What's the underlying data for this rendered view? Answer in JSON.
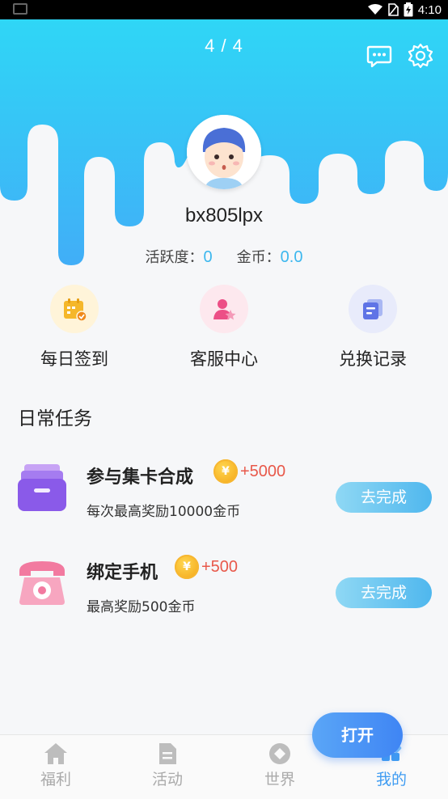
{
  "status_bar": {
    "time": "4:10"
  },
  "header": {
    "page_indicator": "4 / 4",
    "chat_icon": "chat-bubble-icon",
    "settings_icon": "gear-icon"
  },
  "profile": {
    "username": "bx805lpx",
    "activity_label": "活跃度：",
    "activity_value": "0",
    "coins_label": "金币：",
    "coins_value": "0.0"
  },
  "quick_actions": [
    {
      "label": "每日签到",
      "icon": "calendar-check-icon"
    },
    {
      "label": "客服中心",
      "icon": "customer-service-icon"
    },
    {
      "label": "兑换记录",
      "icon": "records-icon"
    }
  ],
  "daily_tasks": {
    "title": "日常任务",
    "items": [
      {
        "name": "参与集卡合成",
        "reward": "+5000",
        "description": "每次最高奖励10000金币",
        "button": "去完成",
        "icon": "card-box-icon"
      },
      {
        "name": "绑定手机",
        "reward": "+500",
        "description": "最高奖励500金币",
        "button": "去完成",
        "icon": "telephone-icon"
      }
    ]
  },
  "fab": {
    "label": "打开"
  },
  "tabs": [
    {
      "label": "福利",
      "icon": "home-icon"
    },
    {
      "label": "活动",
      "icon": "document-icon"
    },
    {
      "label": "世界",
      "icon": "world-icon"
    },
    {
      "label": "我的",
      "icon": "profile-icon",
      "active": true
    }
  ],
  "colors": {
    "accent": "#3cb7ee",
    "header_top": "#2fd6f6",
    "header_bottom": "#41aef7",
    "reward": "#e8584a",
    "active_tab": "#3f9cf2"
  }
}
